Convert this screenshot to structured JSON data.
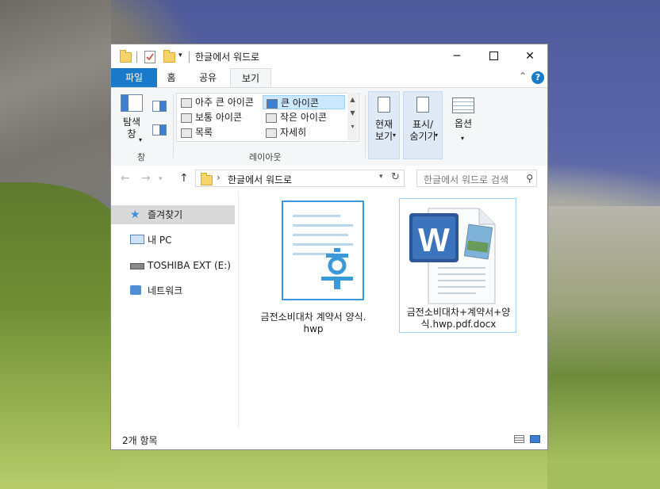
{
  "window": {
    "title": "한글에서 워드로",
    "controls": {
      "minimize": "─",
      "maximize": "☐",
      "close": "✕"
    }
  },
  "ribbon_tabs": [
    {
      "label": "파일"
    },
    {
      "label": "홈"
    },
    {
      "label": "공유"
    },
    {
      "label": "보기"
    }
  ],
  "ribbon": {
    "pane_group": {
      "label": "창",
      "nav_pane_label": "탐색\n창"
    },
    "layout_group": {
      "label": "레이아웃",
      "items": [
        {
          "label": "아주 큰 아이콘"
        },
        {
          "label": "큰 아이콘",
          "selected": true
        },
        {
          "label": "보통 아이콘"
        },
        {
          "label": "작은 아이콘"
        },
        {
          "label": "목록"
        },
        {
          "label": "자세히"
        }
      ]
    },
    "current_view": {
      "label": "현재\n보기"
    },
    "show_hide": {
      "label": "표시/\n숨기기"
    },
    "options": {
      "label": "옵션"
    }
  },
  "address_bar": {
    "path": "한글에서 워드로",
    "search_placeholder": "한글에서 워드로 검색"
  },
  "nav_pane": {
    "items": [
      {
        "label": "즐겨찾기",
        "icon": "star-icon"
      },
      {
        "label": "내 PC",
        "icon": "computer-icon"
      },
      {
        "label": "TOSHIBA EXT (E:)",
        "icon": "drive-icon"
      },
      {
        "label": "네트워크",
        "icon": "network-icon"
      }
    ]
  },
  "files": [
    {
      "name": "금전소비대차 계약서 양식.hwp",
      "icon": "hwp-file-icon"
    },
    {
      "name": "금전소비대차+계약서+양식.hwp.pdf.docx",
      "icon": "word-file-icon",
      "selected": true
    }
  ],
  "status": {
    "item_count": "2개 항목"
  },
  "colors": {
    "accent": "#1979ca",
    "selection": "#cce8ff",
    "selection_border": "#99d1ff",
    "hwp_blue": "#3a9ad9",
    "word_blue": "#2b5797"
  }
}
